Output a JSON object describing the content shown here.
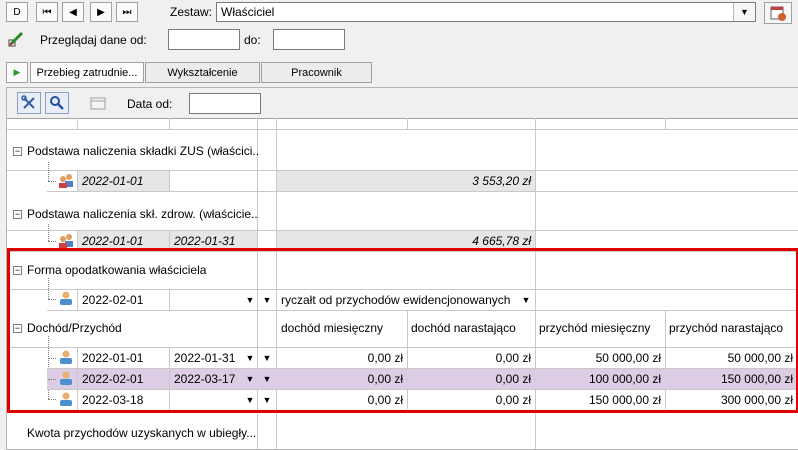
{
  "toolbar": {
    "nav_first_label": "D",
    "nav_prev_start_label": "⏮",
    "nav_prev_label": "◀",
    "nav_next_label": "▶",
    "nav_last_label": "⏭",
    "set_label": "Zestaw:",
    "set_value": "Właściciel",
    "browse_label": "Przeglądaj dane od:",
    "to_label": "do:"
  },
  "tabs": [
    {
      "label": "Przebieg zatrudnie..."
    },
    {
      "label": "Wykształcenie"
    },
    {
      "label": "Pracownik"
    }
  ],
  "subtoolbar": {
    "date_from_label": "Data od:"
  },
  "grid": {
    "groups": {
      "zus": {
        "title": "Podstawa naliczenia składki ZUS (właścici...",
        "row": {
          "date_from": "2022-01-01",
          "date_to": "",
          "amount": "3 553,20 zł"
        }
      },
      "health": {
        "title": "Podstawa naliczenia skł. zdrow. (właścicie...",
        "row": {
          "date_from": "2022-01-01",
          "date_to": "2022-01-31",
          "amount": "4 665,78 zł"
        }
      },
      "tax": {
        "title": "Forma opodatkowania właściciela",
        "row": {
          "date_from": "2022-02-01",
          "date_to": "",
          "value": "ryczałt od przychodów ewidencjonowanych"
        }
      },
      "income": {
        "title": "Dochód/Przychód",
        "headers": [
          "dochód miesięczny",
          "dochód narastająco",
          "przychód miesięczny",
          "przychód narastająco"
        ],
        "rows": [
          {
            "date_from": "2022-01-01",
            "date_to": "2022-01-31",
            "values": [
              "0,00 zł",
              "0,00 zł",
              "50 000,00 zł",
              "50 000,00 zł"
            ]
          },
          {
            "date_from": "2022-02-01",
            "date_to": "2022-03-17",
            "values": [
              "0,00 zł",
              "0,00 zł",
              "100 000,00 zł",
              "150 000,00 zł"
            ]
          },
          {
            "date_from": "2022-03-18",
            "date_to": "",
            "values": [
              "0,00 zł",
              "0,00 zł",
              "150 000,00 zł",
              "300 000,00 zł"
            ]
          }
        ]
      },
      "last": {
        "title": "Kwota przychodów uzyskanych w ubiegły..."
      }
    }
  },
  "colors": {
    "highlight_border": "#e00000",
    "selected_row": "#dccde4",
    "readonly_row": "#e6e6e6"
  }
}
